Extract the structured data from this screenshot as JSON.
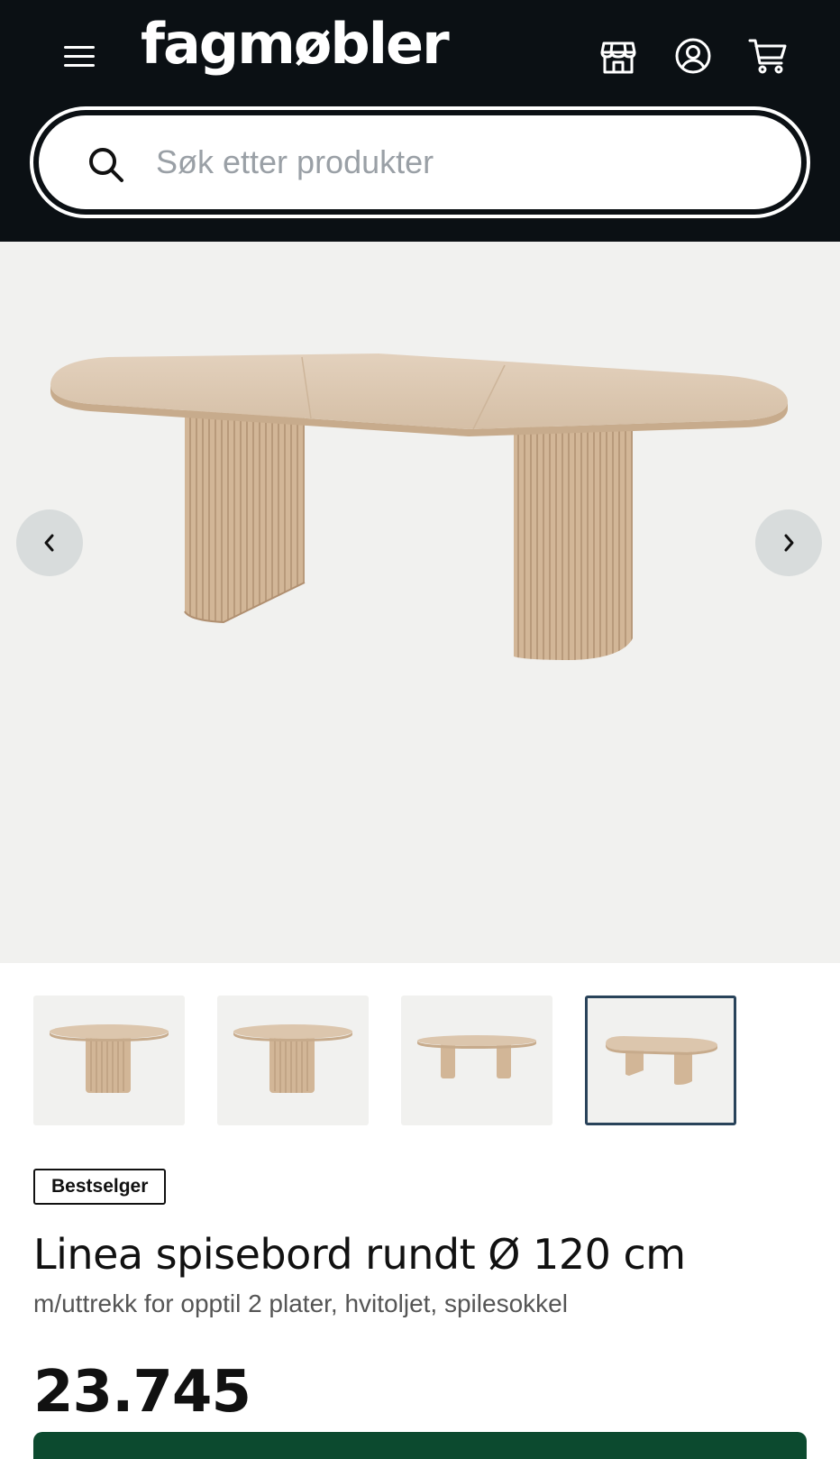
{
  "header": {
    "logo_text": "fagmøbler",
    "background": "#0b1014",
    "icons": [
      "menu-icon",
      "store-icon",
      "account-icon",
      "cart-icon"
    ]
  },
  "search": {
    "placeholder": "Søk etter produkter",
    "value": ""
  },
  "gallery": {
    "background": "#f1f1ef",
    "prev_icon": "chevron-left-icon",
    "next_icon": "chevron-right-icon",
    "thumbnail_count": 4,
    "active_thumbnail": 4
  },
  "product": {
    "badge": "Bestselger",
    "title": "Linea spisebord rundt Ø 120 cm",
    "subtitle": "m/uttrekk for opptil 2 plater, hvitoljet, spilesokkel",
    "price": "23.745",
    "accent_color": "#0c4a2f"
  }
}
